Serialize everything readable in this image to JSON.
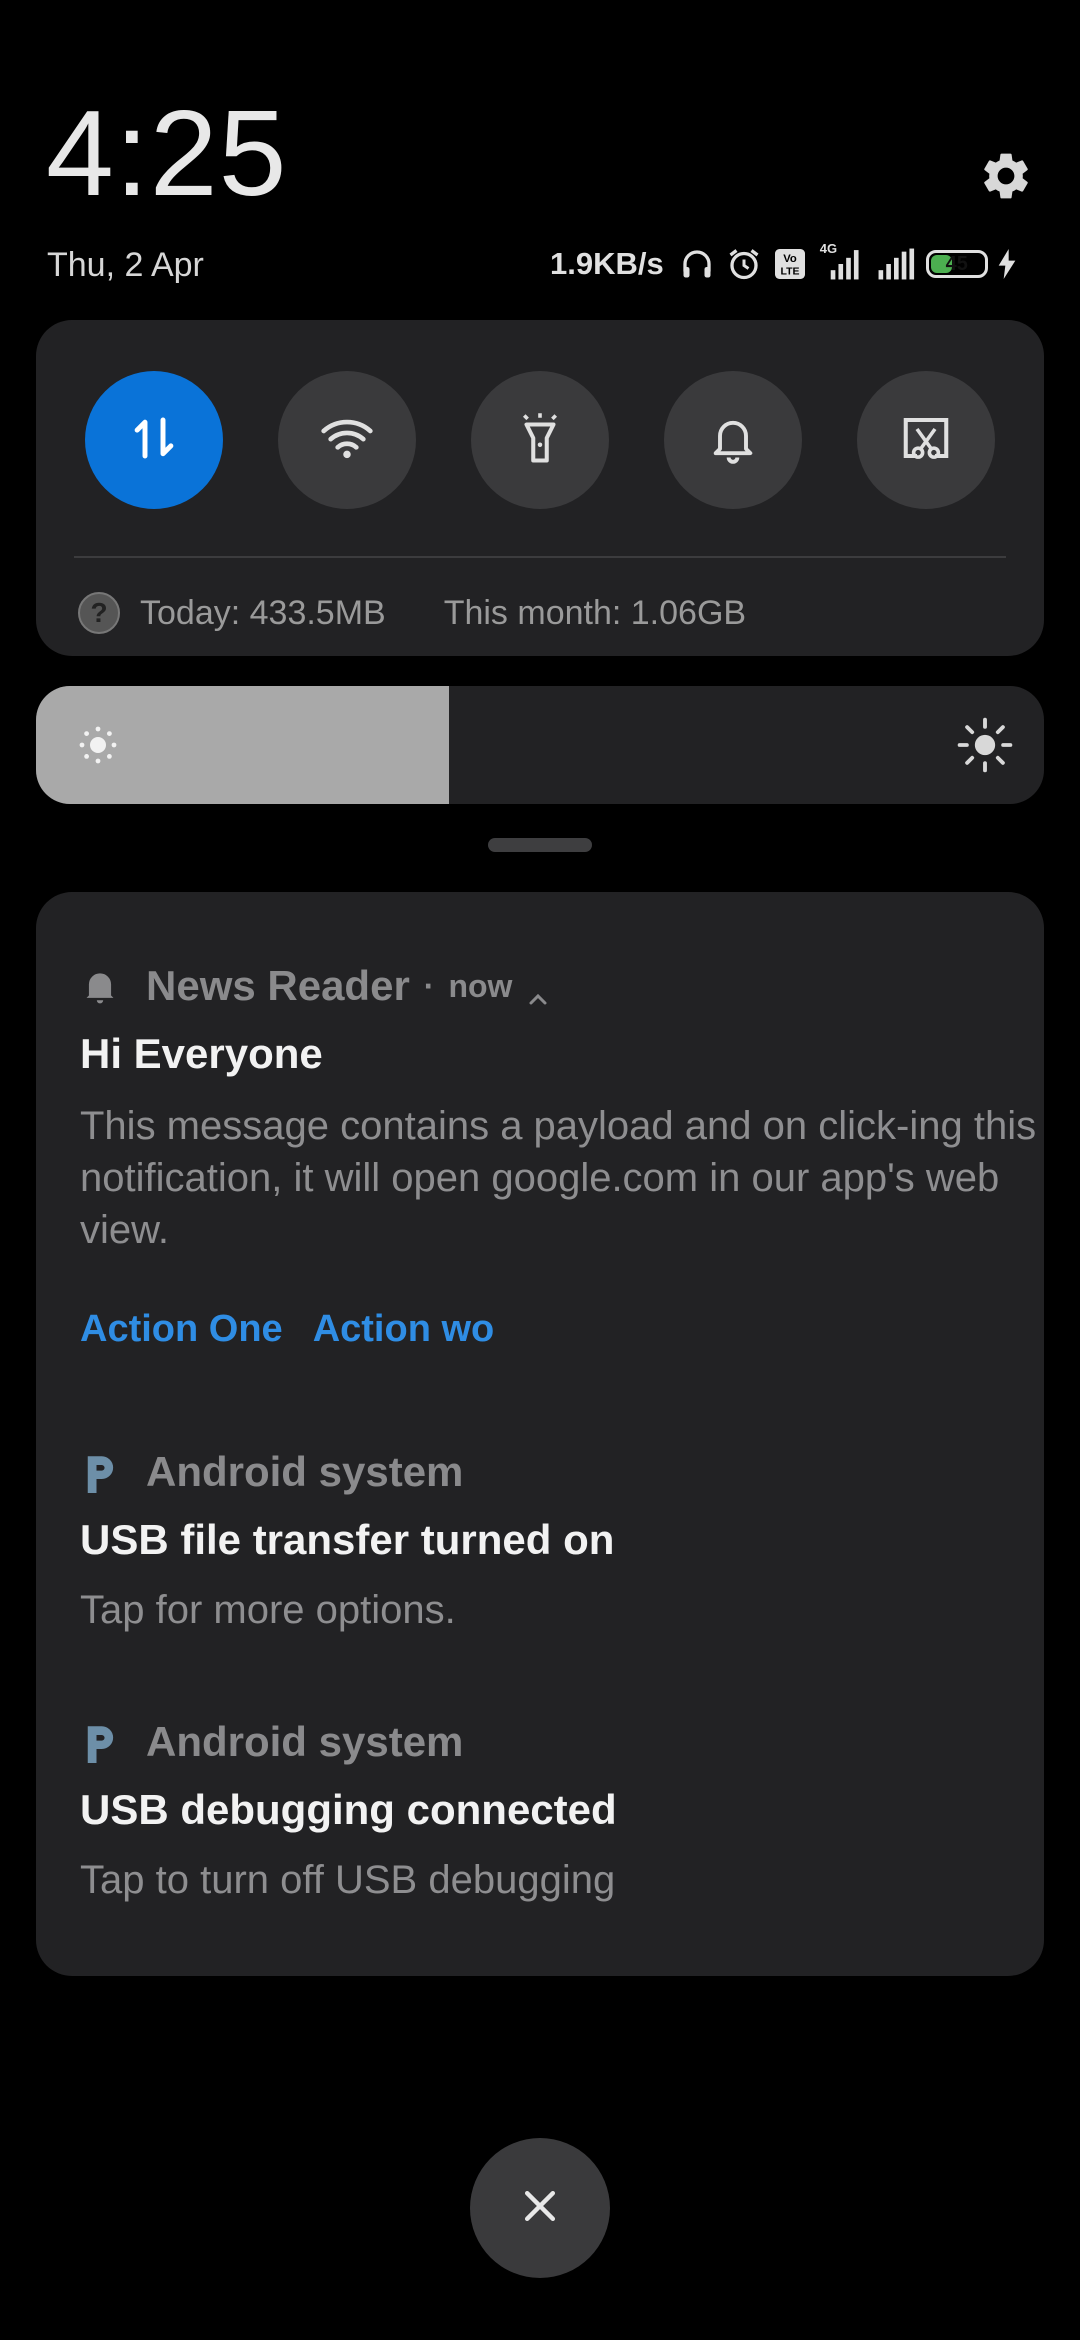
{
  "header": {
    "time": "4:25",
    "date": "Thu, 2 Apr",
    "net_speed": "1.9KB/s",
    "network_type": "4G",
    "battery_level": "45",
    "icons": [
      "headphones-icon",
      "alarm-icon",
      "volte-icon",
      "signal-4g-icon",
      "signal-icon",
      "battery-icon",
      "charging-icon",
      "gear-icon"
    ]
  },
  "quick_settings": {
    "toggles": [
      {
        "name": "mobile-data",
        "icon": "data-transfer-icon",
        "active": true
      },
      {
        "name": "wifi",
        "icon": "wifi-icon",
        "active": false
      },
      {
        "name": "flashlight",
        "icon": "flashlight-icon",
        "active": false
      },
      {
        "name": "sound",
        "icon": "bell-icon",
        "active": false
      },
      {
        "name": "screenshot",
        "icon": "scissors-screenshot-icon",
        "active": false
      }
    ],
    "usage_today": "Today: 433.5MB",
    "usage_month": "This month: 1.06GB"
  },
  "brightness": {
    "level_percent": 41
  },
  "notifications": [
    {
      "app": "News Reader",
      "time": "now",
      "title": "Hi Everyone",
      "body": "This message contains a payload and on click-ing this notification, it will open google.com in our app's web view.",
      "actions": [
        "Action One",
        "Action wo"
      ]
    },
    {
      "app": "Android system",
      "title": "USB file transfer turned on",
      "body": "Tap for more options."
    },
    {
      "app": "Android system",
      "title": "USB debugging connected",
      "body": "Tap to turn off USB debugging"
    }
  ],
  "colors": {
    "accent": "#0a73d8",
    "action_link": "#2f8de4",
    "card_bg": "#222224",
    "battery_fill": "#4caf50"
  }
}
